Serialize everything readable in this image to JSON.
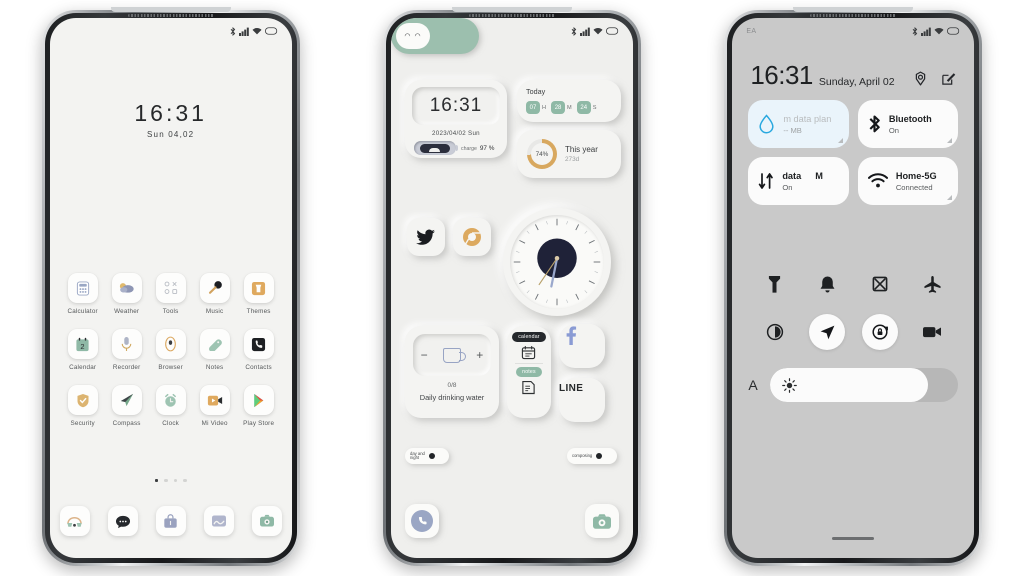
{
  "phone1": {
    "statusbar": {
      "left": "",
      "icons": [
        "bluetooth-icon",
        "signal-icon",
        "wifi-icon",
        "battery-icon"
      ]
    },
    "clock_widget": {
      "time": "16:31",
      "date": "Sun   04,02"
    },
    "apps": [
      [
        {
          "label": "Calculator",
          "icon": "calculator-icon"
        },
        {
          "label": "Weather",
          "icon": "weather-icon"
        },
        {
          "label": "Tools",
          "icon": "tools-icon"
        },
        {
          "label": "Music",
          "icon": "music-icon"
        },
        {
          "label": "Themes",
          "icon": "themes-icon"
        }
      ],
      [
        {
          "label": "Calendar",
          "icon": "calendar-icon"
        },
        {
          "label": "Recorder",
          "icon": "recorder-icon"
        },
        {
          "label": "Browser",
          "icon": "browser-icon"
        },
        {
          "label": "Notes",
          "icon": "notes-icon"
        },
        {
          "label": "Contacts",
          "icon": "contacts-icon"
        }
      ],
      [
        {
          "label": "Security",
          "icon": "security-icon"
        },
        {
          "label": "Compass",
          "icon": "compass-icon"
        },
        {
          "label": "Clock",
          "icon": "clock-icon"
        },
        {
          "label": "Mi Video",
          "icon": "mi-video-icon"
        },
        {
          "label": "Play Store",
          "icon": "play-store-icon"
        }
      ]
    ],
    "page_dots": {
      "count": 4,
      "active": 1
    },
    "dock": [
      {
        "icon": "phone-icon"
      },
      {
        "icon": "messages-icon"
      },
      {
        "icon": "app-vault-icon"
      },
      {
        "icon": "gallery-icon"
      },
      {
        "icon": "camera-icon"
      }
    ]
  },
  "phone2": {
    "statusbar": {
      "icons": [
        "bluetooth-icon",
        "signal-icon",
        "wifi-icon",
        "battery-icon"
      ]
    },
    "clock_widget": {
      "time": "16:31",
      "date": "2023/04/02   Sun",
      "charge_label": "charge",
      "charge_value": "97 %"
    },
    "today_widget": {
      "title": "Today",
      "segments": [
        {
          "value": "07",
          "unit": "H"
        },
        {
          "value": "28",
          "unit": "M"
        },
        {
          "value": "24",
          "unit": "S"
        }
      ]
    },
    "year_widget": {
      "percent": "74%",
      "percent_value": 74,
      "title": "This year",
      "sub": "273d"
    },
    "shortcuts": [
      {
        "name": "twitter-icon",
        "glyph": "🐦"
      },
      {
        "name": "chrome-icon",
        "glyph": "●"
      }
    ],
    "toggle_widget": {
      "name": "cute-toggle",
      "face": "◠ ◠"
    },
    "analog_clock": {
      "name": "analog-clock-widget"
    },
    "water_widget": {
      "minus": "−",
      "plus": "+",
      "count": "0/8",
      "label": "Daily drinking water"
    },
    "stack_widget": {
      "calendar_chip": "calendar",
      "notes_chip": "notes"
    },
    "facebook": {
      "label": "f"
    },
    "line": {
      "label": "LINE"
    },
    "mini_toggles": [
      {
        "label": "day and\nnight"
      },
      {
        "label": "composing"
      }
    ],
    "dock": [
      {
        "icon": "phone-icon"
      },
      {
        "icon": "camera-icon"
      }
    ]
  },
  "phone3": {
    "statusbar": {
      "carrier": "EA",
      "icons": [
        "bluetooth-icon",
        "signal-icon",
        "wifi-icon",
        "battery-icon"
      ]
    },
    "header": {
      "time": "16:31",
      "date": "Sunday, April 02",
      "settings_icon": "settings-gear-icon",
      "edit_icon": "edit-icon"
    },
    "tiles": [
      {
        "name": "data-plan-tile",
        "icon": "water-drop-icon",
        "title": "m data plan",
        "subtitle": "-- MB",
        "style": "dim"
      },
      {
        "name": "bluetooth-tile",
        "icon": "bluetooth-icon",
        "title": "Bluetooth",
        "subtitle": "On",
        "style": "normal"
      },
      {
        "name": "mobile-data-tile",
        "icon": "data-transfer-icon",
        "title": "data",
        "title_extra": "M",
        "subtitle": "On",
        "style": "normal"
      },
      {
        "name": "wifi-tile",
        "icon": "wifi-icon",
        "title": "Home-5G",
        "subtitle": "Connected",
        "style": "normal"
      }
    ],
    "icon_row_1": [
      {
        "name": "flashlight-icon",
        "active": false
      },
      {
        "name": "notification-bell-icon",
        "active": false
      },
      {
        "name": "screenshot-icon",
        "active": false
      },
      {
        "name": "airplane-mode-icon",
        "active": false
      }
    ],
    "icon_row_2": [
      {
        "name": "dark-mode-icon",
        "active": false
      },
      {
        "name": "location-icon",
        "active": true
      },
      {
        "name": "rotation-lock-icon",
        "active": true
      },
      {
        "name": "screen-record-icon",
        "active": false
      }
    ],
    "brightness": {
      "auto_label": "A",
      "icon": "brightness-sun-icon",
      "value": 84
    }
  },
  "colors": {
    "accent_green": "#8fb9a6",
    "accent_gold": "#d8a85f",
    "tile_blue": "#eaf4fb",
    "dark": "#25282c"
  }
}
